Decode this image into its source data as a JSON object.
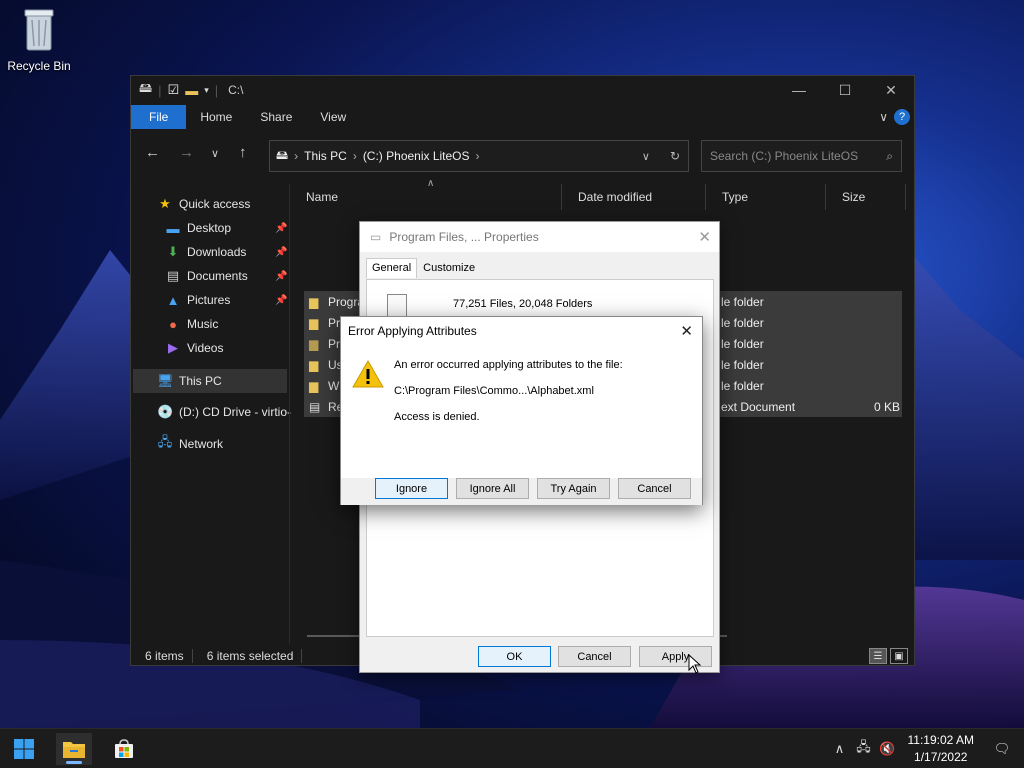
{
  "desktop": {
    "recycle_bin_label": "Recycle Bin"
  },
  "explorer": {
    "title_path": "C:\\",
    "ribbon_tabs": [
      "File",
      "Home",
      "Share",
      "View"
    ],
    "address": {
      "crumbs": [
        "This PC",
        "(C:) Phoenix LiteOS"
      ]
    },
    "search_placeholder": "Search (C:) Phoenix LiteOS",
    "sidebar": {
      "quick_access": "Quick access",
      "desktop": "Desktop",
      "downloads": "Downloads",
      "documents": "Documents",
      "pictures": "Pictures",
      "music": "Music",
      "videos": "Videos",
      "this_pc": "This PC",
      "cd_drive": "(D:) CD Drive - virtio-",
      "network": "Network"
    },
    "columns": {
      "name": "Name",
      "date_modified": "Date modified",
      "type": "Type",
      "size": "Size"
    },
    "files": [
      {
        "name": "Progra",
        "type": "le folder",
        "size": "",
        "icon": "folder-icon"
      },
      {
        "name": "Progra",
        "type": "le folder",
        "size": "",
        "icon": "folder-icon"
      },
      {
        "name": "Progra",
        "type": "le folder",
        "size": "",
        "icon": "folder-icon"
      },
      {
        "name": "Users",
        "type": "le folder",
        "size": "",
        "icon": "folder-icon"
      },
      {
        "name": "Windo",
        "type": "le folder",
        "size": "",
        "icon": "folder-icon"
      },
      {
        "name": "Re",
        "type": "ext Document",
        "size": "0 KB",
        "icon": "text-file-icon"
      }
    ],
    "status": {
      "items": "6 items",
      "selected": "6 items selected"
    }
  },
  "properties_dialog": {
    "title": "Program Files, ... Properties",
    "tabs": [
      "General",
      "Customize"
    ],
    "summary": "77,251 Files, 20,048 Folders",
    "ok": "OK",
    "cancel": "Cancel",
    "apply": "Apply"
  },
  "error_dialog": {
    "title": "Error Applying Attributes",
    "message": "An error occurred applying attributes to the file:",
    "file_path": "C:\\Program Files\\Commo...\\Alphabet.xml",
    "detail": "Access is denied.",
    "buttons": {
      "ignore": "Ignore",
      "ignore_all": "Ignore All",
      "try_again": "Try Again",
      "cancel": "Cancel"
    }
  },
  "taskbar": {
    "time": "11:19:02 AM",
    "date": "1/17/2022"
  },
  "colors": {
    "accent": "#1f6fcf",
    "explorer_bg": "#191919",
    "selection": "#3b3b3b",
    "warning": "#f4c20d"
  }
}
